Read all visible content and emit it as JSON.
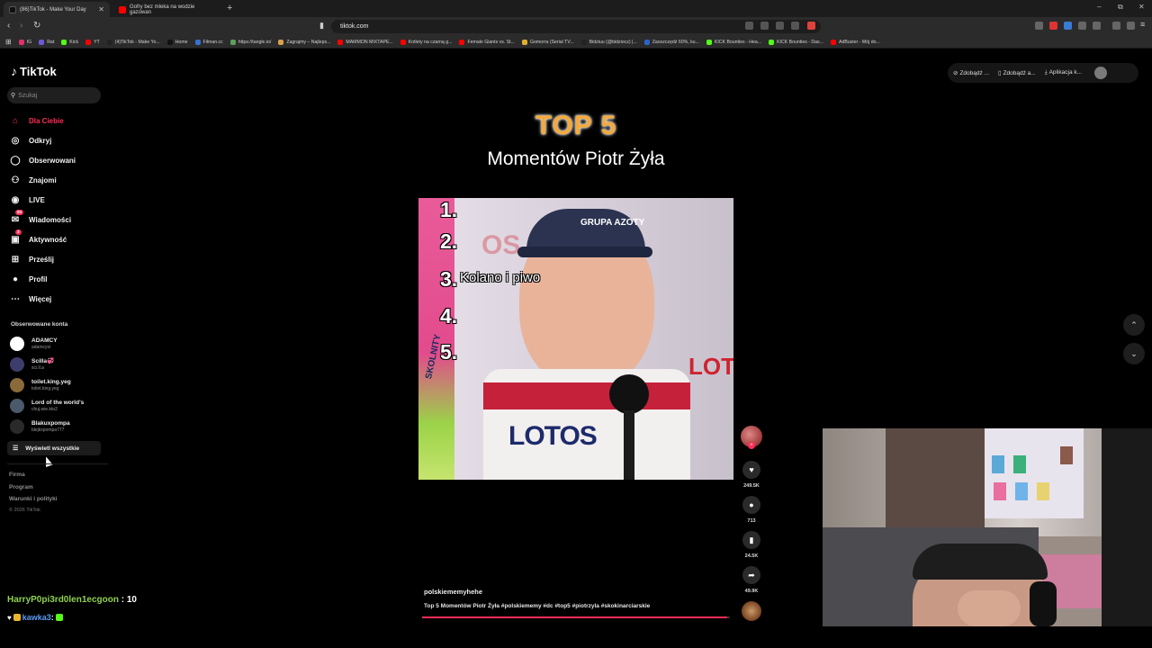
{
  "browser": {
    "tabs": [
      {
        "label": "(86)TikTok - Make Your Day",
        "active": true
      },
      {
        "label": "Gofry bez mleka na wodzie gazowan",
        "active": false
      }
    ],
    "url": "tiktok.com",
    "bookmarks": [
      {
        "label": "IG",
        "color": "#e1306c"
      },
      {
        "label": "Rat",
        "color": "#6b5bd6"
      },
      {
        "label": "Kick",
        "color": "#53fc18"
      },
      {
        "label": "YT",
        "color": "#ff0000"
      },
      {
        "label": "(4)TikTok - Make Yo...",
        "color": "#222222"
      },
      {
        "label": "Home",
        "color": "#111111"
      },
      {
        "label": "Filman.cc",
        "color": "#3a6fd1"
      },
      {
        "label": "https://tangle.io/",
        "color": "#5aa05a"
      },
      {
        "label": "Zagrajmy – Najleps...",
        "color": "#d8a14a"
      },
      {
        "label": "MAMMON MIXTAPE...",
        "color": "#ff0000"
      },
      {
        "label": "Kotlety na czarną g...",
        "color": "#ff0000"
      },
      {
        "label": "Female Giants vs. St...",
        "color": "#ff0000"
      },
      {
        "label": "Gomorra (Serial TV...",
        "color": "#e0b030"
      },
      {
        "label": "Bidziuu (@bidziocz) |...",
        "color": "#222222"
      },
      {
        "label": "Zaoszczędź 60%, ku...",
        "color": "#2f62c9"
      },
      {
        "label": "KICK Bounties - Hea...",
        "color": "#53fc18"
      },
      {
        "label": "KICK Bounties - Das...",
        "color": "#53fc18"
      },
      {
        "label": "AdBuster - Mój do...",
        "color": "#ff0000"
      }
    ]
  },
  "tiktok": {
    "logo": "TikTok",
    "search_placeholder": "Szukaj",
    "nav": [
      {
        "label": "Dla Ciebie",
        "icon": "home-icon",
        "active": true,
        "badge": ""
      },
      {
        "label": "Odkryj",
        "icon": "compass-icon",
        "active": false,
        "badge": ""
      },
      {
        "label": "Obserwowani",
        "icon": "following-icon",
        "active": false,
        "badge": ""
      },
      {
        "label": "Znajomi",
        "icon": "friends-icon",
        "active": false,
        "badge": ""
      },
      {
        "label": "LIVE",
        "icon": "live-icon",
        "active": false,
        "badge": ""
      },
      {
        "label": "Wiadomości",
        "icon": "message-icon",
        "active": false,
        "badge": "83"
      },
      {
        "label": "Aktywność",
        "icon": "activity-icon",
        "active": false,
        "badge": "3"
      },
      {
        "label": "Prześlij",
        "icon": "upload-icon",
        "active": false,
        "badge": ""
      },
      {
        "label": "Profil",
        "icon": "profile-icon",
        "active": false,
        "badge": ""
      },
      {
        "label": "Więcej",
        "icon": "more-icon",
        "active": false,
        "badge": ""
      }
    ],
    "following_title": "Obserwowane konta",
    "following": [
      {
        "name": "ADAMCY",
        "handle": "adamcyxi",
        "color": "#ffffff"
      },
      {
        "name": "Scilla💞",
        "handle": "sci.ll.a",
        "color": "#3d3d6b"
      },
      {
        "name": "toilet.king.yeg",
        "handle": "toilet.king.yeg",
        "color": "#8a6a3a"
      },
      {
        "name": "Lord of the world's",
        "handle": "chuj.wie.kto2",
        "color": "#4a5a6a"
      },
      {
        "name": "Blakuxpompa",
        "handle": "blejkxpompa777",
        "color": "#2a2a2a"
      }
    ],
    "show_all": "Wyświetl wszystkie",
    "footer": [
      "Firma",
      "Program",
      "Warunki i polityki"
    ],
    "copyright": "© 2026 TikTok",
    "header_buttons": [
      "Zdobądź ...",
      "Zdobądź a...",
      "Aplikacja k..."
    ]
  },
  "video": {
    "title_top": "TOP 5",
    "title_sub": "Momentów Piotr Żyła",
    "ranks": [
      "1.",
      "2.",
      "3.",
      "4.",
      "5."
    ],
    "rank3_label": "Kolano i piwo",
    "sponsor_text": "LOTOS",
    "cap_text": "GRUPA AZOTY",
    "ski_text": "SKOLNITY",
    "author": "polskiememyhehe",
    "description": "Top 5 Momentów Piotr Żyła #polskiememy #dc #top5 #piotrzyla #skokinarciarskie",
    "progress": 0.99,
    "counts": {
      "likes": "249.5K",
      "comments": "713",
      "saves": "24.5K",
      "shares": "49.9K"
    }
  },
  "chat": [
    {
      "user": "HarryP0pi3rd0len1ecgoon",
      "sep": " : ",
      "message": "10"
    },
    {
      "user": "kawka3",
      "sep": " : ",
      "message": ""
    }
  ]
}
